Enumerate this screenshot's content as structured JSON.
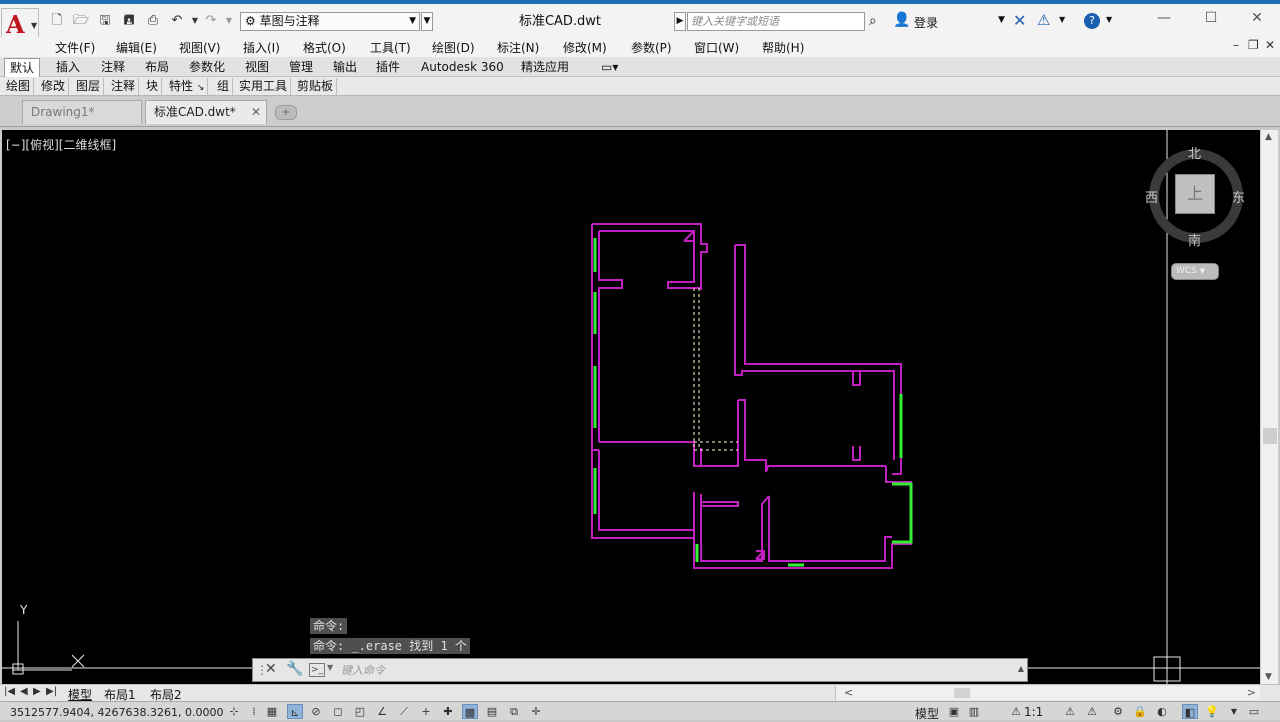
{
  "app": {
    "title": "标准CAD.dwt",
    "workspace": "草图与注释",
    "search_placeholder": "键入关键字或短语",
    "login_label": "登录",
    "brand_color": "#c0141b"
  },
  "menu": [
    "文件(F)",
    "编辑(E)",
    "视图(V)",
    "插入(I)",
    "格式(O)",
    "工具(T)",
    "绘图(D)",
    "标注(N)",
    "修改(M)",
    "参数(P)",
    "窗口(W)",
    "帮助(H)"
  ],
  "ribbon": {
    "tabs": [
      "默认",
      "插入",
      "注释",
      "布局",
      "参数化",
      "视图",
      "管理",
      "输出",
      "插件",
      "Autodesk 360",
      "精选应用"
    ],
    "active_tab": "默认",
    "panels": [
      "绘图",
      "修改",
      "图层",
      "注释",
      "块",
      "特性",
      "组",
      "实用工具",
      "剪贴板"
    ]
  },
  "doc_tabs": [
    {
      "label": "Drawing1*",
      "active": false
    },
    {
      "label": "标准CAD.dwt*",
      "active": true
    }
  ],
  "viewport": {
    "label": "[−][俯视][二维线框]",
    "background": "#000000",
    "wall_color": "#c020c0",
    "window_color": "#33ee33",
    "selected_color": "#ffffcc"
  },
  "viewcube": {
    "north": "北",
    "south": "南",
    "east": "东",
    "west": "西",
    "top_face": "上",
    "coord_system": "WCS"
  },
  "ucs": {
    "y_axis": "Y",
    "x_axis": "X"
  },
  "command": {
    "history": [
      "命令:",
      "命令: _.erase 找到 1 个"
    ],
    "input_placeholder": "键入命令"
  },
  "layout_tabs": [
    "模型",
    "布局1",
    "布局2"
  ],
  "status": {
    "coordinates": "3512577.9404, 4267638.3261, 0.0000",
    "model_label": "模型",
    "scale": "1:1"
  }
}
